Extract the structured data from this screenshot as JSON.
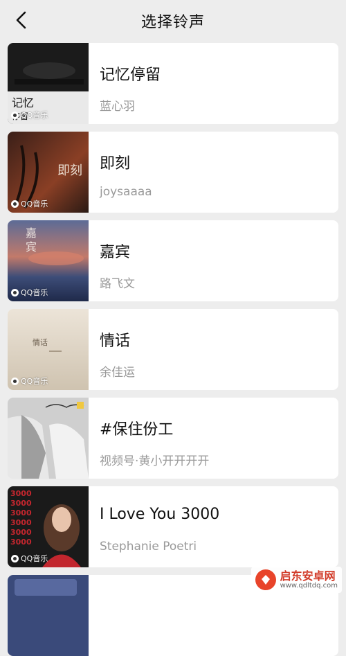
{
  "header": {
    "title": "选择铃声",
    "back_icon": "chevron-left-icon"
  },
  "ringtones": [
    {
      "title": "记忆停留",
      "artist": "蓝心羽",
      "badge": "QQ音乐"
    },
    {
      "title": "即刻",
      "artist": "joysaaaa",
      "badge": "QQ音乐"
    },
    {
      "title": "嘉宾",
      "artist": "路飞文",
      "badge": "QQ音乐"
    },
    {
      "title": "情话",
      "artist": "余佳运",
      "badge": "QQ音乐"
    },
    {
      "title": "#保住份工",
      "artist": "视频号·黄小开开开开",
      "badge": ""
    },
    {
      "title": "I Love You 3000",
      "artist": "Stephanie Poetri",
      "badge": "QQ音乐"
    }
  ],
  "watermark": {
    "name": "启东安卓网",
    "url": "www.qdltdq.com"
  }
}
